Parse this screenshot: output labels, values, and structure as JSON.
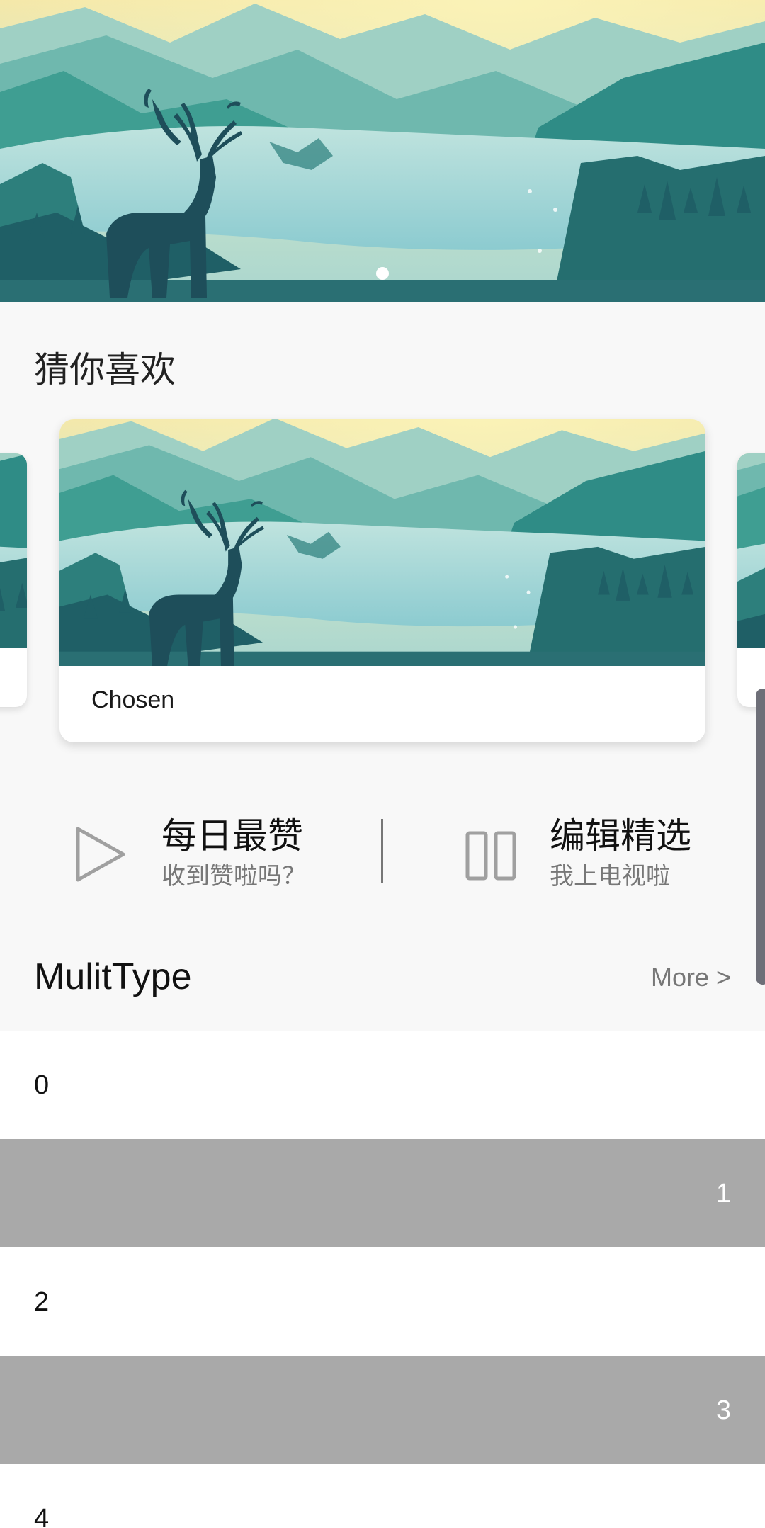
{
  "banner": {
    "image": "deer-lake-illustration",
    "indicator_count": 1,
    "active_indicator": 0
  },
  "guess_section": {
    "title": "猜你喜欢",
    "cards": [
      {
        "label": "Chosen",
        "image": "deer-lake-illustration"
      }
    ]
  },
  "features": [
    {
      "icon": "play-icon",
      "title": "每日最赞",
      "subtitle": "收到赞啦吗？"
    },
    {
      "icon": "columns-icon",
      "title": "编辑精选",
      "subtitle": "我上电视啦"
    }
  ],
  "multitype": {
    "title": "MulitType",
    "more_label": "More >"
  },
  "list_items": [
    "0",
    "1",
    "2",
    "3",
    "4"
  ],
  "colors": {
    "background": "#f8f8f8",
    "gray_row": "#a9a9a9",
    "white_row": "#ffffff",
    "subtitle_text": "#777777"
  }
}
